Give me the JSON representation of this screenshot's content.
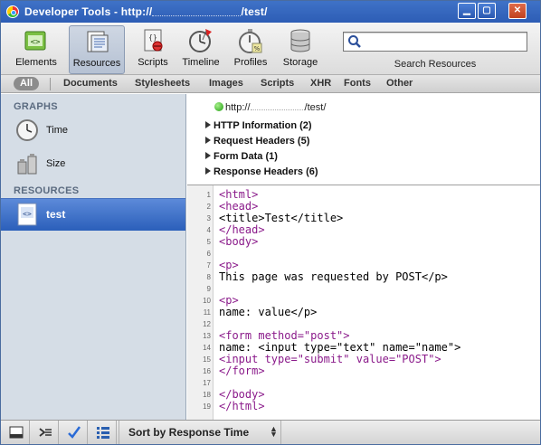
{
  "window": {
    "title_prefix": "Developer Tools - http://",
    "title_suffix": "/test/",
    "controls": [
      "minimize",
      "maximize",
      "close"
    ]
  },
  "toolbar": {
    "tools": [
      {
        "label": "Elements",
        "icon": "elements-icon"
      },
      {
        "label": "Resources",
        "icon": "resources-icon"
      },
      {
        "label": "Scripts",
        "icon": "scripts-icon"
      },
      {
        "label": "Timeline",
        "icon": "timeline-icon"
      },
      {
        "label": "Profiles",
        "icon": "profiles-icon"
      },
      {
        "label": "Storage",
        "icon": "storage-icon"
      }
    ],
    "active": "Resources",
    "search_label": "Search Resources",
    "search_value": ""
  },
  "filters": [
    "All",
    "Documents",
    "Stylesheets",
    "Images",
    "Scripts",
    "XHR",
    "Fonts",
    "Other"
  ],
  "sidebar": {
    "graphs_heading": "GRAPHS",
    "graphs": [
      {
        "label": "Time",
        "icon": "clock-icon"
      },
      {
        "label": "Size",
        "icon": "weights-icon"
      }
    ],
    "resources_heading": "RESOURCES",
    "resources": [
      {
        "label": "test",
        "icon": "html-document-icon",
        "selected": true
      }
    ]
  },
  "request": {
    "url_prefix": "http://",
    "url_suffix": "/test/",
    "sections": [
      "HTTP Information (2)",
      "Request Headers (5)",
      "Form Data (1)",
      "Response Headers (6)"
    ]
  },
  "source_lines": [
    "1",
    "2",
    "3",
    "4",
    "5",
    "6",
    "7",
    "8",
    "9",
    "10",
    "11",
    "12",
    "13",
    "14",
    "15",
    "16",
    "17",
    "18",
    "19"
  ],
  "source_text": {
    "l1": "<html>",
    "l2": "<head>",
    "l3": "<title>Test</title>",
    "l4": "</head>",
    "l5": "<body>",
    "l7": "<p>",
    "l8": "This page was requested by POST</p>",
    "l10": "<p>",
    "l11": "name: value</p>",
    "l13": "<form method=\"post\">",
    "l14": "name: <input type=\"text\" name=\"name\">",
    "l15": "<input type=\"submit\" value=\"POST\">",
    "l16": "</form>",
    "l18": "</body>",
    "l19": "</html>"
  },
  "statusbar": {
    "sort_label": "Sort by Response Time"
  }
}
